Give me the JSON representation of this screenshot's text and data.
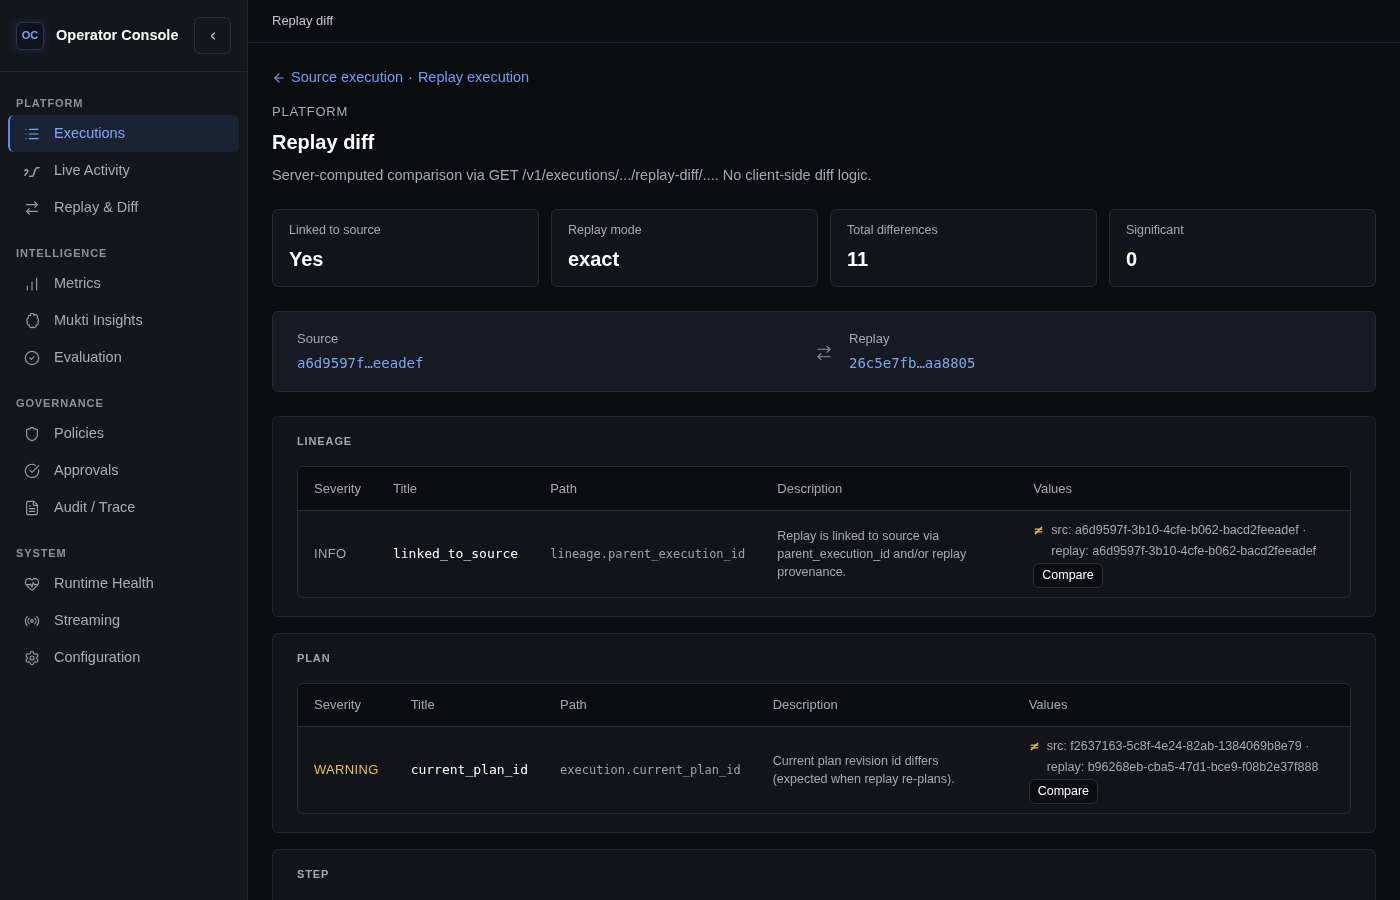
{
  "sidebar": {
    "logo_text": "OC",
    "app_name": "Operator Console",
    "sections": [
      {
        "label": "PLATFORM",
        "items": [
          {
            "label": "Executions",
            "selected": true
          },
          {
            "label": "Live Activity",
            "selected": false
          },
          {
            "label": "Replay & Diff",
            "selected": false
          }
        ]
      },
      {
        "label": "INTELLIGENCE",
        "items": [
          {
            "label": "Metrics",
            "selected": false
          },
          {
            "label": "Mukti Insights",
            "selected": false
          },
          {
            "label": "Evaluation",
            "selected": false
          }
        ]
      },
      {
        "label": "GOVERNANCE",
        "items": [
          {
            "label": "Policies",
            "selected": false
          },
          {
            "label": "Approvals",
            "selected": false
          },
          {
            "label": "Audit / Trace",
            "selected": false
          }
        ]
      },
      {
        "label": "SYSTEM",
        "items": [
          {
            "label": "Runtime Health",
            "selected": false
          },
          {
            "label": "Streaming",
            "selected": false
          },
          {
            "label": "Configuration",
            "selected": false
          }
        ]
      }
    ]
  },
  "top_bar": {
    "title": "Replay diff"
  },
  "breadcrumb": {
    "links": [
      "Source execution",
      "Replay execution"
    ],
    "separator": "·"
  },
  "page": {
    "eyebrow": "PLATFORM",
    "title": "Replay diff",
    "description": "Server-computed comparison via GET /v1/executions/.../replay-diff/.... No client-side diff logic."
  },
  "stats": [
    {
      "label": "Linked to source",
      "value": "Yes"
    },
    {
      "label": "Replay mode",
      "value": "exact"
    },
    {
      "label": "Total differences",
      "value": "11"
    },
    {
      "label": "Significant",
      "value": "0"
    }
  ],
  "comparison": {
    "source": {
      "label": "Source",
      "id": "a6d9597f…eeadef"
    },
    "replay": {
      "label": "Replay",
      "id": "26c5e7fb…aa8805"
    }
  },
  "groups": [
    {
      "title": "LINEAGE",
      "columns": [
        "Severity",
        "Title",
        "Path",
        "Description",
        "Values"
      ],
      "rows": [
        {
          "kind": "info",
          "severity": "INFO",
          "title": "linked_to_source",
          "path": "lineage.parent_execution_id",
          "description": "Replay is linked to source via parent_execution_id and/or replay provenance.",
          "values": "src: a6d9597f-3b10-4cfe-b062-bacd2feeadef · replay: a6d9597f-3b10-4cfe-b062-bacd2feeadef",
          "action": "Compare"
        }
      ]
    },
    {
      "title": "PLAN",
      "columns": [
        "Severity",
        "Title",
        "Path",
        "Description",
        "Values"
      ],
      "rows": [
        {
          "kind": "warning",
          "severity": "WARNING",
          "title": "current_plan_id",
          "path": "execution.current_plan_id",
          "description": "Current plan revision id differs (expected when replay re-plans).",
          "values": "src: f2637163-5c8f-4e24-82ab-1384069b8e79 · replay: b96268eb-cba5-47d1-bce9-f08b2e37f888",
          "action": "Compare"
        }
      ]
    },
    {
      "title": "STEP"
    }
  ]
}
